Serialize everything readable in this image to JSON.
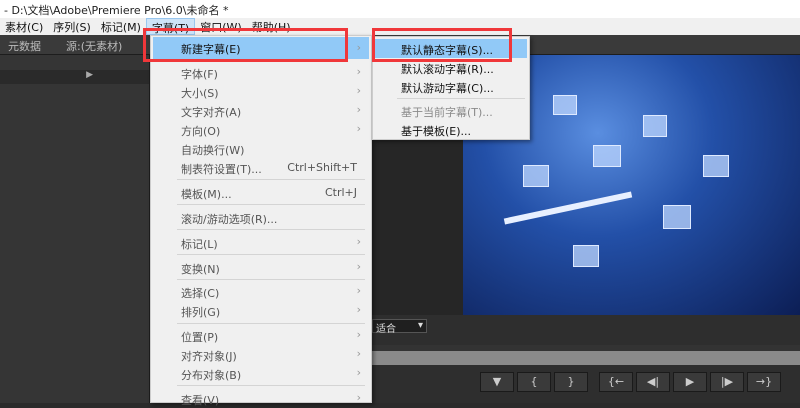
{
  "window": {
    "title": "- D:\\文档\\Adobe\\Premiere Pro\\6.0\\未命名 *"
  },
  "menubar": [
    "素材(C)",
    "序列(S)",
    "标记(M)",
    "字幕(T)",
    "窗口(W)",
    "帮助(H)"
  ],
  "panels": {
    "metadata_tab": "元数据",
    "source_tab": "源:(无素材)",
    "fit_select": "适合"
  },
  "title_menu": {
    "new_title": "新建字幕(E)",
    "font": "字体(F)",
    "size": "大小(S)",
    "align": "文字对齐(A)",
    "orientation": "方向(O)",
    "word_wrap": "自动换行(W)",
    "tab_stops": "制表符设置(T)...",
    "tab_stops_shortcut": "Ctrl+Shift+T",
    "templates": "模板(M)...",
    "templates_shortcut": "Ctrl+J",
    "roll_crawl": "滚动/游动选项(R)...",
    "logo": "标记(L)",
    "transform": "变换(N)",
    "select": "选择(C)",
    "arrange": "排列(G)",
    "position": "位置(P)",
    "align_objects": "对齐对象(J)",
    "distribute": "分布对象(B)",
    "view": "查看(V)"
  },
  "new_title_submenu": [
    "默认静态字幕(S)...",
    "默认滚动字幕(R)...",
    "默认游动字幕(C)...",
    "基于当前字幕(T)...",
    "基于模板(E)..."
  ],
  "controls": [
    "▼",
    "{",
    "}",
    "{←",
    "◀|",
    "▶",
    "|▶",
    "→}"
  ],
  "accent": {
    "highlight": "#91c9f7",
    "annotation": "#f0373a"
  }
}
